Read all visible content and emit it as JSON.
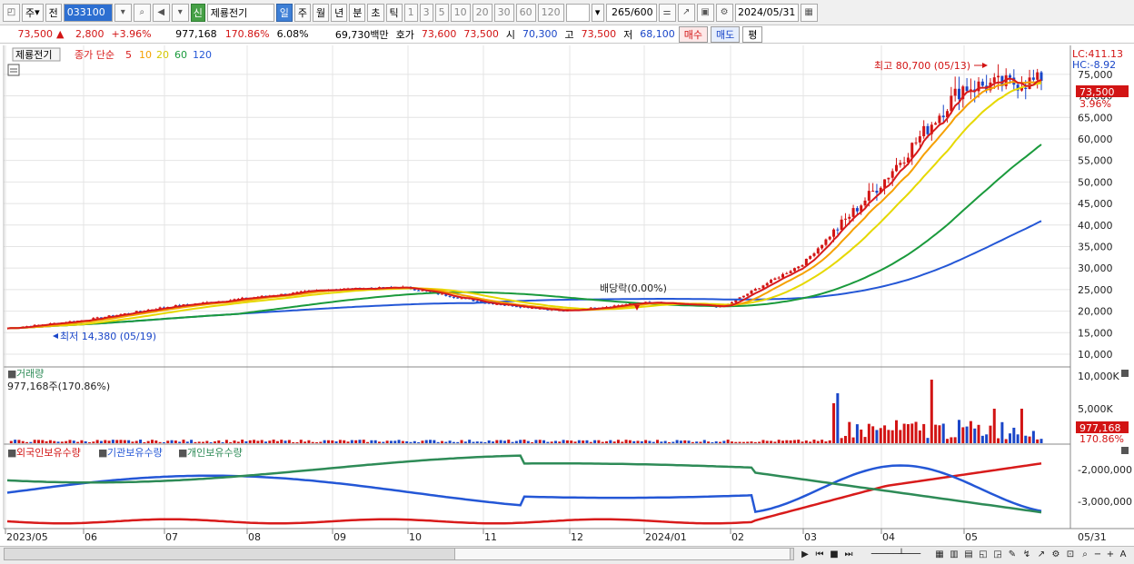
{
  "toolbar": {
    "period_label": "주",
    "all_label": "전",
    "stock_code": "033100",
    "new_badge": "신",
    "stock_name": "제룡전기",
    "timeframes": [
      "일",
      "주",
      "월",
      "년",
      "분",
      "초",
      "틱"
    ],
    "active_timeframe": "일",
    "intervals": [
      "1",
      "3",
      "5",
      "10",
      "20",
      "30",
      "60",
      "120"
    ],
    "count_value": "265",
    "count_total": "/600",
    "date_value": "2024/05/31"
  },
  "quote": {
    "price": "73,500",
    "arrow": "▲",
    "change": "2,800",
    "change_pct": "+3.96%",
    "volume": "977,168",
    "volume_ratio": "170.86%",
    "turnover": "6.08%",
    "amount": "69,730백만",
    "hoga_label": "호가",
    "ask": "73,600",
    "bid": "73,500",
    "open_label": "시",
    "open": "70,300",
    "high_label": "고",
    "high": "73,500",
    "low_label": "저",
    "low": "68,100",
    "buy_label": "매수",
    "sell_label": "매도",
    "flat_label": "평"
  },
  "price_panel": {
    "stock_tag": "제룡전기",
    "ma_label": "종가 단순",
    "ma_periods": [
      {
        "label": "5",
        "color": "#d81b1b"
      },
      {
        "label": "10",
        "color": "#f5a000"
      },
      {
        "label": "20",
        "color": "#e6d800"
      },
      {
        "label": "60",
        "color": "#1a9a3c"
      },
      {
        "label": "120",
        "color": "#2457d6"
      }
    ],
    "lc": "LC:411.13",
    "hc": "HC:-8.92",
    "max_annotation": "최고 80,700 (05/13)",
    "min_annotation": "최저 14,380 (05/19)",
    "dividend_annotation": "배당락(0.00%)",
    "current_price_tag": "73,500",
    "current_pct_tag": "3.96%",
    "y_ticks": [
      "75,000",
      "70,000",
      "65,000",
      "60,000",
      "55,000",
      "50,000",
      "45,000",
      "40,000",
      "35,000",
      "30,000",
      "25,000",
      "20,000",
      "15,000",
      "10,000"
    ]
  },
  "volume_panel": {
    "title": "거래량",
    "value_label": "977,168주(170.86%)",
    "y_ticks": [
      "10,000K",
      "5,000K"
    ],
    "current_tag": "977,168",
    "current_pct_tag": "170.86%"
  },
  "holdings_panel": {
    "legend": [
      {
        "label": "외국인보유수량",
        "color": "#d81b1b"
      },
      {
        "label": "기관보유수량",
        "color": "#2457d6"
      },
      {
        "label": "개인보유수량",
        "color": "#2e8b57"
      }
    ],
    "y_ticks": [
      "-2,000,000",
      "-3,000,000"
    ]
  },
  "x_axis": {
    "labels": [
      "2023/05",
      "06",
      "07",
      "08",
      "09",
      "10",
      "11",
      "12",
      "2024/01",
      "02",
      "03",
      "04",
      "05"
    ],
    "end_label": "05/31"
  },
  "colors": {
    "up": "#d21414",
    "down": "#1a46c8",
    "ma5": "#d81b1b",
    "ma10": "#f5a000",
    "ma20": "#e6d800",
    "ma60": "#1a9a3c",
    "ma120": "#2457d6"
  },
  "chart_data": {
    "type": "line",
    "price_range": [
      10000,
      80700
    ],
    "x_range": [
      "2023/05",
      "2024/05/31"
    ],
    "key_points": [
      {
        "x": "2023/05",
        "close": 16000
      },
      {
        "x": "2023/06",
        "close": 18000
      },
      {
        "x": "2023/07",
        "close": 21000
      },
      {
        "x": "2023/08",
        "close": 23000
      },
      {
        "x": "2023/09",
        "close": 25000
      },
      {
        "x": "2023/10",
        "close": 25500
      },
      {
        "x": "2023/11",
        "close": 22000
      },
      {
        "x": "2023/12",
        "close": 20000
      },
      {
        "x": "2024/01",
        "close": 22000
      },
      {
        "x": "2024/02",
        "close": 21000
      },
      {
        "x": "2024/03",
        "close": 31000
      },
      {
        "x": "2024/04",
        "close": 50000
      },
      {
        "x": "2024/05",
        "close": 72000
      },
      {
        "x": "2024/05/31",
        "close": 73500
      }
    ]
  }
}
